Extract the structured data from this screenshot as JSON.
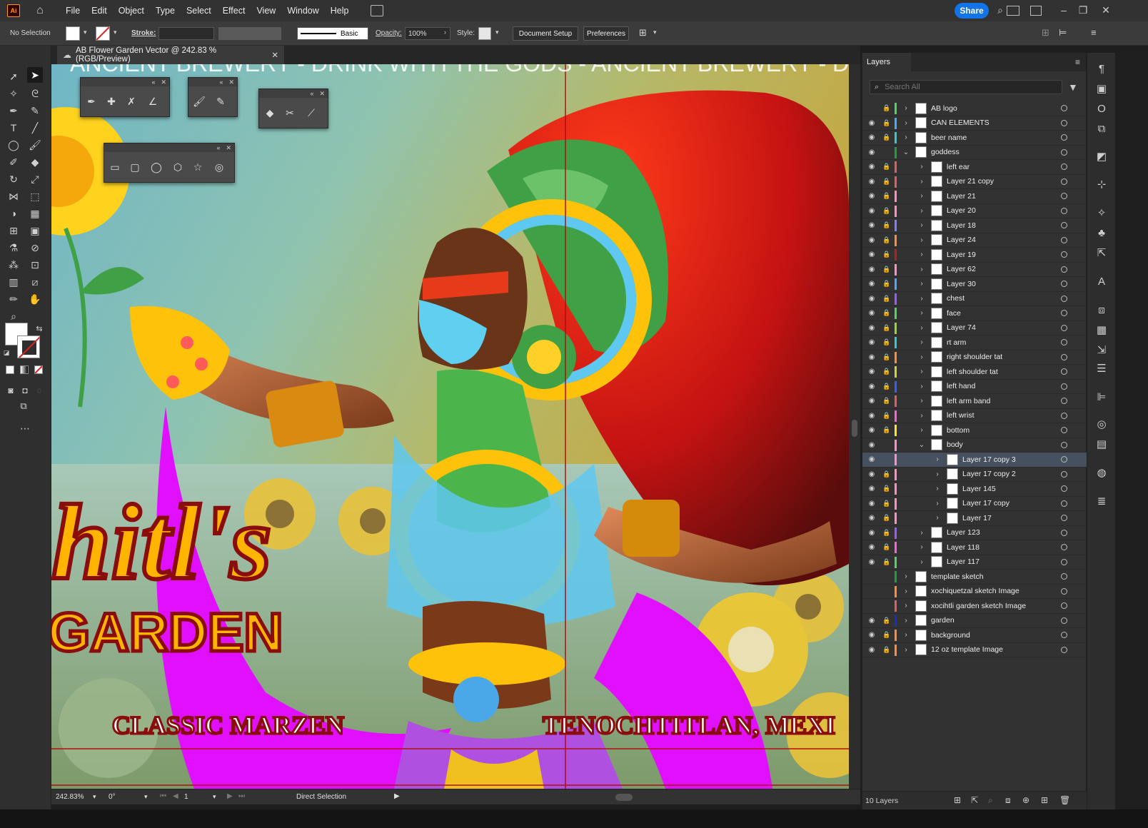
{
  "app": {
    "logo_text": "Ai"
  },
  "menu": [
    "File",
    "Edit",
    "Object",
    "Type",
    "Select",
    "Effect",
    "View",
    "Window",
    "Help"
  ],
  "share_label": "Share",
  "control": {
    "selection": "No Selection",
    "stroke_label": "Stroke:",
    "stroke_profile": "Basic",
    "opacity_label": "Opacity:",
    "opacity_value": "100%",
    "style_label": "Style:",
    "document_setup": "Document Setup",
    "preferences": "Preferences"
  },
  "document": {
    "tab_title": "AB Flower Garden Vector @ 242.83 % (RGB/Preview)"
  },
  "artwork": {
    "top_banner": "ANCIENT BREWERY - DRINK WITH THE GODS - ANCIENT BREWERY - DRINK",
    "script_title": "hitl's",
    "subtitle": "GARDEN",
    "left_caption": "CLASSIC MARZEN",
    "right_caption": "TENOCHTITLAN, MEXI"
  },
  "status": {
    "zoom": "242.83%",
    "rotation": "0°",
    "artboard": "1",
    "tool": "Direct Selection"
  },
  "layers_panel": {
    "title": "Layers",
    "search_placeholder": "Search All",
    "footer_count": "10 Layers",
    "rows": [
      {
        "name": "AB logo",
        "level": 0,
        "eye": false,
        "lock": true,
        "color": "#4fd65d",
        "expanded": false
      },
      {
        "name": "CAN ELEMENTS",
        "level": 0,
        "eye": true,
        "lock": true,
        "color": "#4aa8ff",
        "expanded": false
      },
      {
        "name": "beer name",
        "level": 0,
        "eye": true,
        "lock": true,
        "color": "#35c9d0",
        "expanded": false
      },
      {
        "name": "goddess",
        "level": 0,
        "eye": true,
        "lock": false,
        "color": "#1f9e3a",
        "expanded": true
      },
      {
        "name": "left ear",
        "level": 1,
        "eye": true,
        "lock": true,
        "color": "#e35f5f",
        "expanded": false
      },
      {
        "name": "Layer 21 copy",
        "level": 1,
        "eye": true,
        "lock": true,
        "color": "#e35f5f",
        "expanded": false
      },
      {
        "name": "Layer 21",
        "level": 1,
        "eye": true,
        "lock": true,
        "color": "#ff8fbe",
        "expanded": false
      },
      {
        "name": "Layer 20",
        "level": 1,
        "eye": true,
        "lock": true,
        "color": "#ff8fbe",
        "expanded": false
      },
      {
        "name": "Layer 18",
        "level": 1,
        "eye": true,
        "lock": true,
        "color": "#7f7fff",
        "expanded": false
      },
      {
        "name": "Layer 24",
        "level": 1,
        "eye": true,
        "lock": true,
        "color": "#ff8a3a",
        "expanded": false
      },
      {
        "name": "Layer 19",
        "level": 1,
        "eye": true,
        "lock": true,
        "color": "#b81f1f",
        "expanded": false
      },
      {
        "name": "Layer 62",
        "level": 1,
        "eye": true,
        "lock": true,
        "color": "#ff8fbe",
        "expanded": false
      },
      {
        "name": "Layer 30",
        "level": 1,
        "eye": true,
        "lock": true,
        "color": "#4aa8ff",
        "expanded": false
      },
      {
        "name": "chest",
        "level": 1,
        "eye": true,
        "lock": true,
        "color": "#9b59ff",
        "expanded": false
      },
      {
        "name": "face",
        "level": 1,
        "eye": true,
        "lock": true,
        "color": "#4fd65d",
        "expanded": false
      },
      {
        "name": "Layer 74",
        "level": 1,
        "eye": true,
        "lock": true,
        "color": "#9bd62a",
        "expanded": false
      },
      {
        "name": "rt arm",
        "level": 1,
        "eye": true,
        "lock": true,
        "color": "#35c9d0",
        "expanded": false
      },
      {
        "name": "right shoulder tat",
        "level": 1,
        "eye": true,
        "lock": true,
        "color": "#ff8a3a",
        "expanded": false
      },
      {
        "name": "left shoulder tat",
        "level": 1,
        "eye": true,
        "lock": true,
        "color": "#c7d630",
        "expanded": false
      },
      {
        "name": "left hand",
        "level": 1,
        "eye": true,
        "lock": true,
        "color": "#3a5cff",
        "expanded": false
      },
      {
        "name": "left arm band",
        "level": 1,
        "eye": true,
        "lock": true,
        "color": "#e35f5f",
        "expanded": false
      },
      {
        "name": "left wrist",
        "level": 1,
        "eye": true,
        "lock": true,
        "color": "#ff5fd8",
        "expanded": false
      },
      {
        "name": "bottom",
        "level": 1,
        "eye": true,
        "lock": true,
        "color": "#ffe02a",
        "expanded": false
      },
      {
        "name": "body",
        "level": 1,
        "eye": true,
        "lock": false,
        "color": "#ff8fbe",
        "expanded": true
      },
      {
        "name": "Layer 17 copy 3",
        "level": 2,
        "eye": true,
        "lock": false,
        "color": "#ff8fbe",
        "expanded": false,
        "selected": true
      },
      {
        "name": "Layer 17 copy 2",
        "level": 2,
        "eye": true,
        "lock": true,
        "color": "#ff8fbe",
        "expanded": false
      },
      {
        "name": "Layer 145",
        "level": 2,
        "eye": true,
        "lock": true,
        "color": "#ff8fbe",
        "expanded": false
      },
      {
        "name": "Layer 17 copy",
        "level": 2,
        "eye": true,
        "lock": true,
        "color": "#ff8fbe",
        "expanded": false
      },
      {
        "name": "Layer 17",
        "level": 2,
        "eye": true,
        "lock": true,
        "color": "#ff8fbe",
        "expanded": false
      },
      {
        "name": "Layer 123",
        "level": 1,
        "eye": true,
        "lock": true,
        "color": "#9b59ff",
        "expanded": false
      },
      {
        "name": "Layer 118",
        "level": 1,
        "eye": true,
        "lock": true,
        "color": "#ff5fd8",
        "expanded": false
      },
      {
        "name": "Layer 117",
        "level": 1,
        "eye": true,
        "lock": true,
        "color": "#4fd65d",
        "expanded": false
      },
      {
        "name": "template sketch",
        "level": 0,
        "eye": false,
        "lock": false,
        "color": "#1f9e3a",
        "expanded": false
      },
      {
        "name": "xochiquetzal sketch Image",
        "level": 0,
        "eye": false,
        "lock": false,
        "color": "#ff8a3a",
        "expanded": false
      },
      {
        "name": "xocihtli garden sketch Image",
        "level": 0,
        "eye": false,
        "lock": false,
        "color": "#e35f5f",
        "expanded": false
      },
      {
        "name": "garden",
        "level": 0,
        "eye": true,
        "lock": true,
        "color": "#1b2bd0",
        "expanded": false
      },
      {
        "name": "background",
        "level": 0,
        "eye": true,
        "lock": true,
        "color": "#ff8a3a",
        "expanded": false
      },
      {
        "name": "12 oz template Image",
        "level": 0,
        "eye": true,
        "lock": true,
        "color": "#ff8a3a",
        "expanded": false
      }
    ]
  }
}
